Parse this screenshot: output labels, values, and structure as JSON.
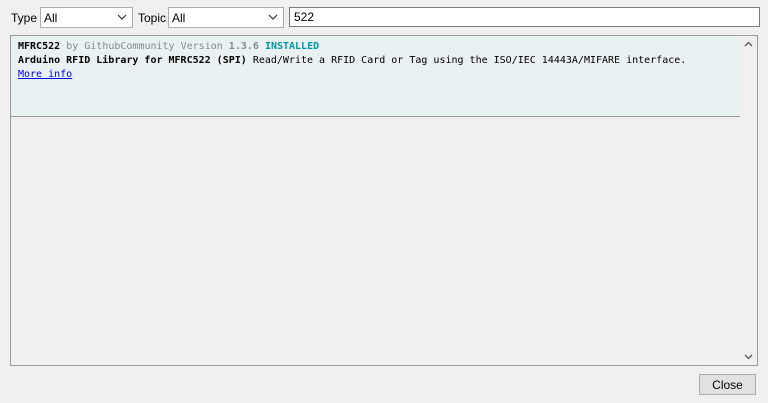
{
  "filters": {
    "type_label": "Type",
    "type_value": "All",
    "topic_label": "Topic",
    "topic_value": "All",
    "search_value": "522"
  },
  "library": {
    "name": "MFRC522",
    "by": "by",
    "author": "GithubCommunity",
    "version_label": "Version",
    "version": "1.3.6",
    "status": "INSTALLED",
    "desc_title": "Arduino RFID Library for MFRC522 (SPI)",
    "desc_text": "Read/Write a RFID Card or Tag using the ISO/IEC 14443A/MIFARE interface.",
    "more_info": "More info"
  },
  "footer": {
    "close_label": "Close"
  },
  "colors": {
    "installed": "#00979c",
    "link": "#0000ee",
    "entry_bg": "#e9f1f2"
  }
}
